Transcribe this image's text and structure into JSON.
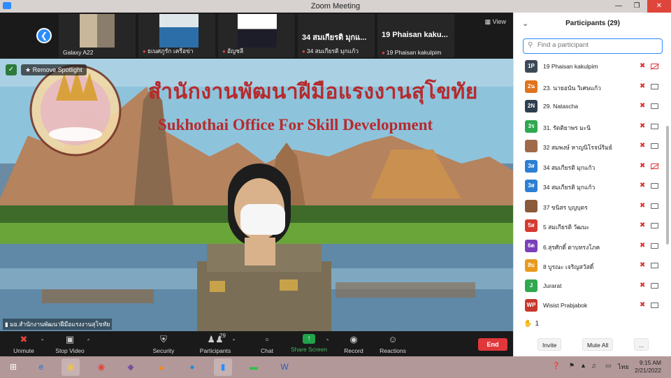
{
  "window": {
    "title": "Zoom Meeting"
  },
  "gallery": {
    "view_label": "View",
    "tiles": [
      {
        "name": "Galaxy A22"
      },
      {
        "name": "ธเนศภูรัก เครือข่า"
      },
      {
        "name": "อัญชลี"
      },
      {
        "big": "34 สมเกียรติ มุกแ...",
        "name": "34 สมเกียรติ มุกแก้ว"
      },
      {
        "big": "19 Phaisan kaku...",
        "name": "19 Phaisan kakulpim"
      }
    ]
  },
  "stage": {
    "remove_spotlight": "Remove Spotlight",
    "thai_title": "สำนักงานพัฒนาฝีมือแรงงานสุโขทัย",
    "english_title": "Sukhothai  Office For Skill Development",
    "speaker_name": "มอ.สำนักงานพัฒนาฝีมือแรงงานสุโขทัย"
  },
  "toolbar": {
    "unmute": "Unmute",
    "stop_video": "Stop Video",
    "security": "Security",
    "participants": "Participants",
    "participants_count": "29",
    "chat": "Chat",
    "share_screen": "Share Screen",
    "record": "Record",
    "reactions": "Reactions",
    "end": "End"
  },
  "panel": {
    "title": "Participants (29)",
    "search_placeholder": "Find a participant",
    "participants": [
      {
        "initials": "1P",
        "color": "#3b4a56",
        "name": "19 Phaisan kakulpim",
        "cam_off": true
      },
      {
        "initials": "2น",
        "color": "#e0731f",
        "name": "23. นายอนัน วิเศษแก้ว",
        "cam_off": false
      },
      {
        "initials": "2N",
        "color": "#2d3e4f",
        "name": "29. Natascha",
        "cam_off": false
      },
      {
        "initials": "3ร",
        "color": "#2fa84f",
        "name": "31. รัตติยาพร มะนิ",
        "cam_off": false
      },
      {
        "initials": "",
        "color": "#a06a4a",
        "name": "32 สมพงษ์ หาญนิโรจน์ริมย์",
        "cam_off": false
      },
      {
        "initials": "3ส",
        "color": "#2d7fd3",
        "name": "34 สมเกียรติ มุกแก้ว",
        "cam_off": true
      },
      {
        "initials": "3ส",
        "color": "#2d7fd3",
        "name": "34 สมเกียรติ มุกแก้ว",
        "cam_off": false
      },
      {
        "initials": "",
        "color": "#8a5a3a",
        "name": "37 ขนิสร บุญบุตร",
        "cam_off": false
      },
      {
        "initials": "5ส",
        "color": "#d63a2f",
        "name": "5 สมเกียรติ วัฒนะ",
        "cam_off": false
      },
      {
        "initials": "6ต",
        "color": "#7b3fb8",
        "name": "6.สุรศักดิ์ ตาบทรงโภค",
        "cam_off": false
      },
      {
        "initials": "8บ",
        "color": "#e89a1c",
        "name": "8 บูรณะ เจริญสวัสดิ์",
        "cam_off": false
      },
      {
        "initials": "J",
        "color": "#2fa84f",
        "name": "Jurarat",
        "cam_off": false
      },
      {
        "initials": "WP",
        "color": "#c8372d",
        "name": "Wisist Prabjabok",
        "cam_off": false
      }
    ],
    "raised_count": "1",
    "invite": "Invite",
    "mute_all": "Mute All",
    "more": "..."
  },
  "taskbar": {
    "time": "9:15 AM",
    "date": "2/21/2022",
    "lang": "ไทย"
  }
}
